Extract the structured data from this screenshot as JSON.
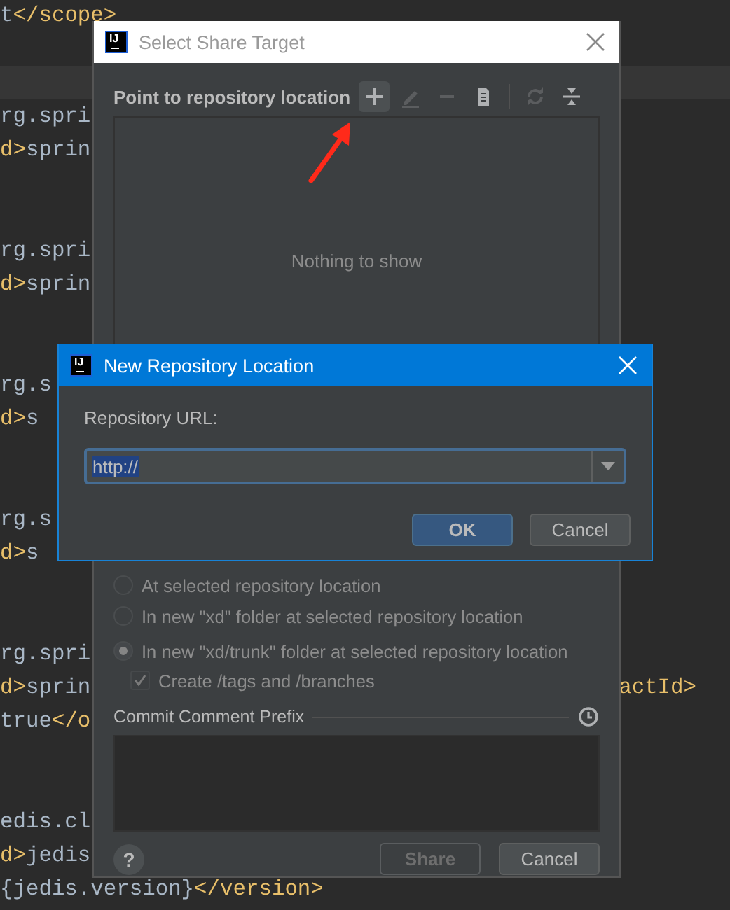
{
  "editor": {
    "current_line_highlight": true,
    "lines": [
      {
        "segments": [
          {
            "kind": "text",
            "text": "t"
          },
          {
            "kind": "tag",
            "text": "</scope>"
          }
        ]
      },
      {
        "segments": [
          {
            "kind": "text",
            "text": "rg.spri"
          }
        ]
      },
      {
        "segments": [
          {
            "kind": "tag",
            "text": "d>"
          },
          {
            "kind": "text",
            "text": "sprin"
          }
        ]
      },
      {
        "segments": [
          {
            "kind": "text",
            "text": "rg.spri"
          }
        ]
      },
      {
        "segments": [
          {
            "kind": "tag",
            "text": "d>"
          },
          {
            "kind": "text",
            "text": "sprin"
          }
        ]
      },
      {
        "segments": [
          {
            "kind": "text",
            "text": "rg.s"
          }
        ]
      },
      {
        "segments": [
          {
            "kind": "tag",
            "text": "d>"
          },
          {
            "kind": "text",
            "text": "s"
          }
        ]
      },
      {
        "segments": [
          {
            "kind": "text",
            "text": "rg.s"
          }
        ]
      },
      {
        "segments": [
          {
            "kind": "tag",
            "text": "d>"
          },
          {
            "kind": "text",
            "text": "s"
          }
        ]
      },
      {
        "segments": [
          {
            "kind": "text",
            "text": "rg.spri"
          }
        ]
      },
      {
        "segments": [
          {
            "kind": "tag",
            "text": "d>"
          },
          {
            "kind": "text",
            "text": "sprin"
          }
        ],
        "right_segments": [
          {
            "kind": "tag",
            "text": "actId>"
          }
        ]
      },
      {
        "segments": [
          {
            "kind": "text",
            "text": "true"
          },
          {
            "kind": "tag",
            "text": "</o"
          }
        ]
      },
      {
        "segments": [
          {
            "kind": "text",
            "text": "edis.cl"
          }
        ]
      },
      {
        "segments": [
          {
            "kind": "tag",
            "text": "d>"
          },
          {
            "kind": "text",
            "text": "jedis"
          }
        ]
      },
      {
        "segments": [
          {
            "kind": "text",
            "text": "{jedis.version}"
          },
          {
            "kind": "tag",
            "text": "</version>"
          }
        ]
      }
    ]
  },
  "share_dialog": {
    "logo_text": "IJ",
    "title": "Select Share Target",
    "active": false,
    "toolbar_label": "Point to repository location",
    "tools": [
      {
        "disabled": false,
        "hovered": true
      },
      {
        "disabled": true,
        "hovered": false
      },
      {
        "disabled": true,
        "hovered": false
      },
      {
        "disabled": false,
        "hovered": false
      },
      {
        "disabled": true,
        "hovered": false
      },
      {
        "disabled": false,
        "hovered": false
      }
    ],
    "empty_text": "Nothing to show",
    "options": [
      {
        "label": "At selected repository location",
        "selected": false,
        "disabled": true
      },
      {
        "label": "In new \"xd\" folder at selected repository location",
        "selected": false,
        "disabled": true
      },
      {
        "label": "In new \"xd/trunk\" folder at selected repository location",
        "selected": true,
        "disabled": true
      }
    ],
    "checkbox": {
      "label": "Create /tags and /branches",
      "checked": true,
      "disabled": true
    },
    "comment_title": "Commit Comment Prefix",
    "help": "?",
    "buttons": [
      {
        "label": "Share",
        "disabled": true,
        "default": false
      },
      {
        "label": "Cancel",
        "disabled": false,
        "default": false
      }
    ]
  },
  "repo_dialog": {
    "logo_text": "IJ",
    "title": "New Repository Location",
    "active": true,
    "url_label": "Repository URL:",
    "url_value": "http://",
    "value_selected": true,
    "buttons": [
      {
        "label": "OK",
        "disabled": false,
        "default": true
      },
      {
        "label": "Cancel",
        "disabled": false,
        "default": false
      }
    ]
  }
}
